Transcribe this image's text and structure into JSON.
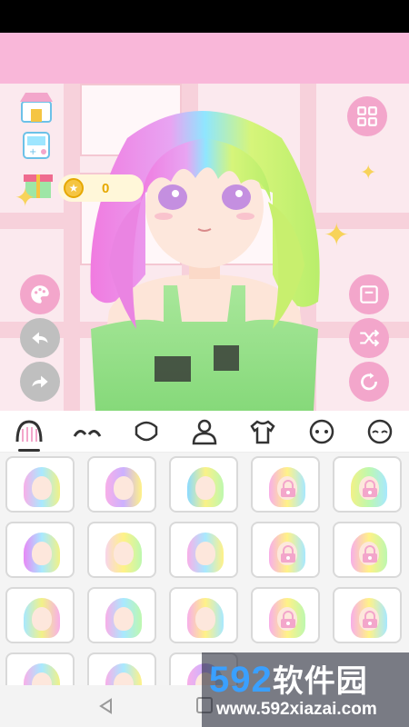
{
  "header": {
    "coins": "0"
  },
  "tabs": [
    {
      "name": "hair",
      "active": true
    },
    {
      "name": "eyebrows",
      "active": false
    },
    {
      "name": "face-shape",
      "active": false
    },
    {
      "name": "body",
      "active": false
    },
    {
      "name": "clothes",
      "active": false
    },
    {
      "name": "expression",
      "active": false
    },
    {
      "name": "accessory",
      "active": false
    }
  ],
  "grid": {
    "items": [
      {
        "colors": [
          "#f7a6e6",
          "#9ee6ff",
          "#f0f07a"
        ],
        "locked": false
      },
      {
        "colors": [
          "#f7a6e6",
          "#c6a8ff",
          "#fff07a"
        ],
        "locked": false
      },
      {
        "colors": [
          "#7ed6ff",
          "#f9f07a",
          "#b6f7a6"
        ],
        "locked": false
      },
      {
        "colors": [
          "#f7a6e6",
          "#fff07a",
          "#9ee6ff"
        ],
        "locked": true
      },
      {
        "colors": [
          "#f0f07a",
          "#b6f7a6",
          "#9ee6ff"
        ],
        "locked": true
      },
      {
        "colors": [
          "#e57bf5",
          "#9ee6ff",
          "#f0f07a"
        ],
        "locked": false
      },
      {
        "colors": [
          "#f7d0e6",
          "#fff07a",
          "#b6f7a6"
        ],
        "locked": false
      },
      {
        "colors": [
          "#f7a6e6",
          "#9ee6ff",
          "#fff07a"
        ],
        "locked": false
      },
      {
        "colors": [
          "#f7a6e6",
          "#fff07a",
          "#9ee6ff"
        ],
        "locked": true
      },
      {
        "colors": [
          "#f7a6e6",
          "#fff07a",
          "#b6f7a6"
        ],
        "locked": true
      },
      {
        "colors": [
          "#9ee6ff",
          "#f0f07a",
          "#f7a6e6"
        ],
        "locked": false
      },
      {
        "colors": [
          "#f7a6e6",
          "#9ee6ff",
          "#b6f7a6"
        ],
        "locked": false
      },
      {
        "colors": [
          "#f7a6e6",
          "#fff07a",
          "#9ee6ff"
        ],
        "locked": false
      },
      {
        "colors": [
          "#f7a6e6",
          "#fff07a",
          "#b6f7a6"
        ],
        "locked": true
      },
      {
        "colors": [
          "#f7a6e6",
          "#fff07a",
          "#9ee6ff"
        ],
        "locked": true
      },
      {
        "colors": [
          "#f7a6e6",
          "#9ee6ff",
          "#f0f07a"
        ],
        "locked": false
      },
      {
        "colors": [
          "#f7a6e6",
          "#9ee6ff",
          "#fff07a"
        ],
        "locked": false
      },
      {
        "colors": [
          "#f7a6e6",
          "#c6a8ff",
          "#9ee6ff"
        ],
        "locked": false
      }
    ]
  },
  "watermark": {
    "brand_num": "592",
    "brand_cn": "软件园",
    "url": "www.592xiazai.com"
  },
  "colors": {
    "banner": "#f9b7d9",
    "accent": "#f3a6cb",
    "undo": "#bfbfbf"
  }
}
